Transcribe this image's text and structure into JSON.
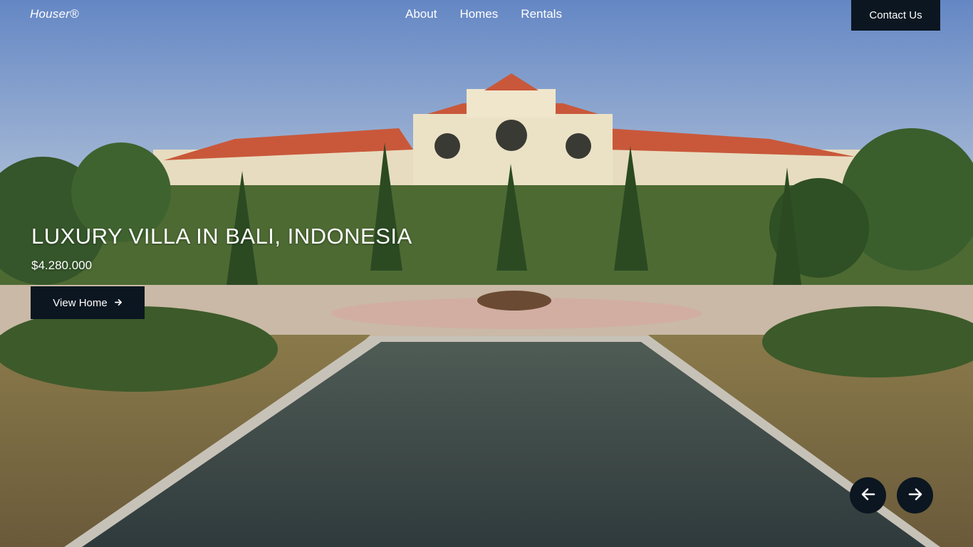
{
  "header": {
    "logo": "Houser®",
    "nav": [
      "About",
      "Homes",
      "Rentals"
    ],
    "contact_label": "Contact Us"
  },
  "listing": {
    "title": "LUXURY VILLA IN BALI, INDONESIA",
    "price": "$4.280.000",
    "view_label": "View Home",
    "view_icon": "arrow-right-icon"
  },
  "carousel": {
    "prev_icon": "arrow-left-icon",
    "next_icon": "arrow-right-icon"
  },
  "colors": {
    "button_bg": "#0b1621",
    "text": "#ffffff"
  }
}
